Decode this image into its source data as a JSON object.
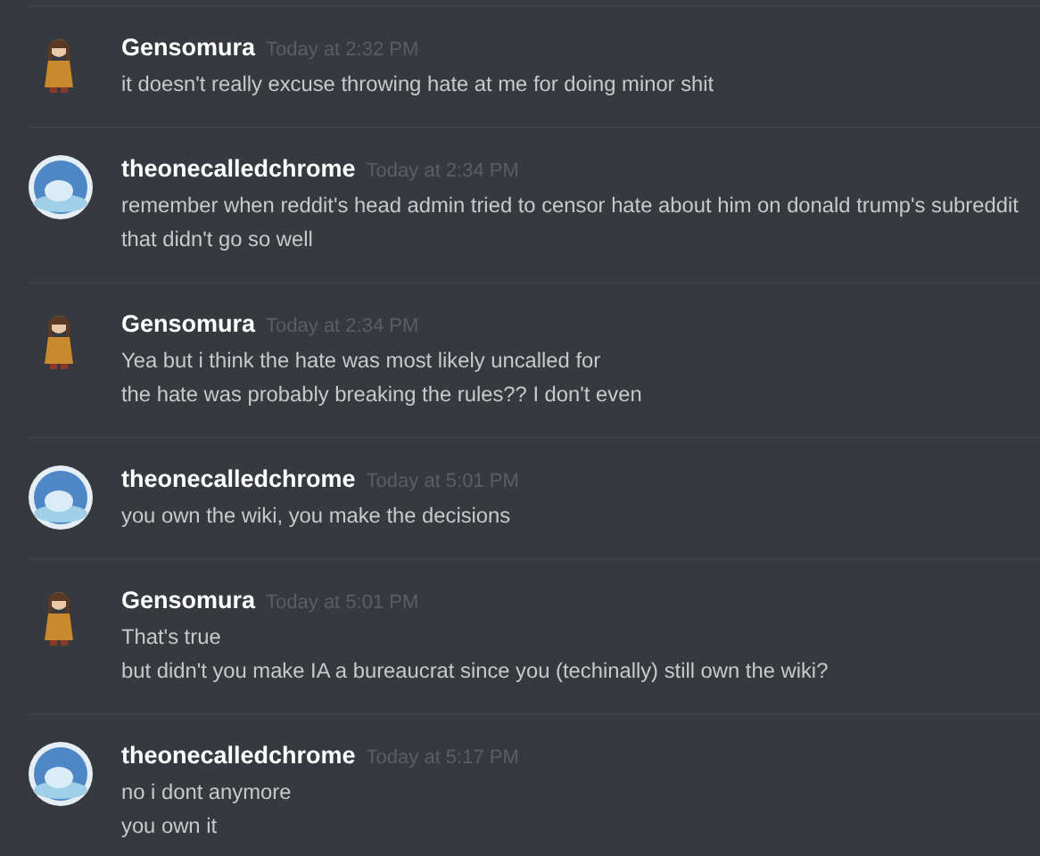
{
  "messages": [
    {
      "author": "Gensomura",
      "kind": "figure",
      "time": "Today at 2:32 PM",
      "lines": [
        "it doesn't really excuse throwing hate at me for doing minor shit"
      ]
    },
    {
      "author": "theonecalledchrome",
      "kind": "round",
      "time": "Today at 2:34 PM",
      "lines": [
        "remember when reddit's head admin tried to censor hate about him on donald trump's subreddit",
        "that didn't go so well"
      ]
    },
    {
      "author": "Gensomura",
      "kind": "figure",
      "time": "Today at 2:34 PM",
      "lines": [
        "Yea but i think the hate was most likely uncalled for",
        "the hate was probably breaking the rules?? I don't even"
      ]
    },
    {
      "author": "theonecalledchrome",
      "kind": "round",
      "time": "Today at 5:01 PM",
      "lines": [
        "you own the wiki, you make the decisions"
      ]
    },
    {
      "author": "Gensomura",
      "kind": "figure",
      "time": "Today at 5:01 PM",
      "lines": [
        "That's true",
        "but didn't you make IA a bureaucrat since you (techinally) still own the wiki?"
      ]
    },
    {
      "author": "theonecalledchrome",
      "kind": "round",
      "time": "Today at 5:17 PM",
      "lines": [
        "no i dont anymore",
        "you own it"
      ]
    }
  ]
}
